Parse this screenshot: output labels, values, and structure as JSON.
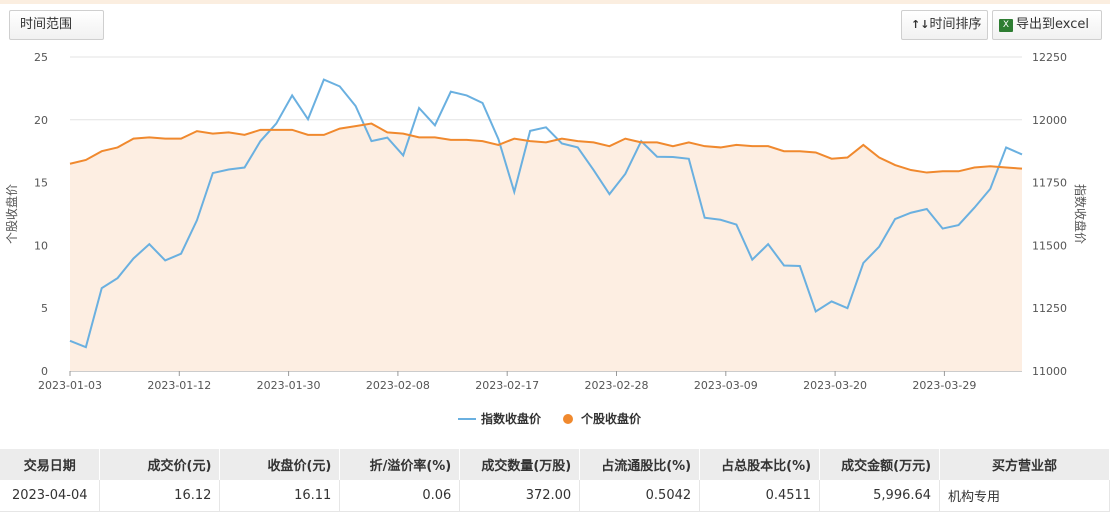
{
  "toolbar": {
    "range_label": "时间范围",
    "sort_label": "时间排序",
    "sort_icon": "↑↓",
    "export_label": "导出到excel",
    "export_icon": "X"
  },
  "chart_data": {
    "type": "line",
    "x_ticks": [
      "2023-01-03",
      "2023-01-12",
      "2023-01-30",
      "2023-02-08",
      "2023-02-17",
      "2023-02-28",
      "2023-03-09",
      "2023-03-20",
      "2023-03-29"
    ],
    "y_left": {
      "label": "个股收盘价",
      "ticks": [
        0,
        5,
        10,
        15,
        20,
        25
      ],
      "range": [
        0,
        25
      ]
    },
    "y_right": {
      "label": "指数收盘价",
      "ticks": [
        11000,
        11250,
        11500,
        11750,
        12000,
        12250
      ],
      "range": [
        11000,
        12250
      ]
    },
    "series": [
      {
        "name": "指数收盘价",
        "axis": "right",
        "color": "#6ab0e0",
        "values": [
          11120,
          11095,
          11330,
          11370,
          11448,
          11505,
          11440,
          11467,
          11600,
          11788,
          11802,
          11810,
          11915,
          11985,
          12097,
          12002,
          12160,
          12133,
          12055,
          11915,
          11929,
          11858,
          12047,
          11978,
          12112,
          12097,
          12067,
          11923,
          11713,
          11956,
          11970,
          11906,
          11890,
          11800,
          11704,
          11785,
          11915,
          11853,
          11852,
          11845,
          11610,
          11602,
          11583,
          11443,
          11505,
          11420,
          11418,
          11237,
          11277,
          11250,
          11430,
          11495,
          11605,
          11630,
          11645,
          11567,
          11581,
          11650,
          11725,
          11890,
          11862
        ]
      },
      {
        "name": "个股收盘价",
        "axis": "left",
        "color": "#f0892e",
        "values": [
          16.5,
          16.8,
          17.5,
          17.8,
          18.5,
          18.6,
          18.5,
          18.5,
          19.1,
          18.9,
          19.0,
          18.8,
          19.2,
          19.2,
          19.2,
          18.8,
          18.8,
          19.3,
          19.5,
          19.7,
          19.0,
          18.9,
          18.6,
          18.6,
          18.4,
          18.4,
          18.3,
          18.0,
          18.5,
          18.3,
          18.2,
          18.5,
          18.3,
          18.2,
          17.9,
          18.5,
          18.2,
          18.2,
          17.9,
          18.2,
          17.9,
          17.8,
          18.0,
          17.9,
          17.9,
          17.5,
          17.5,
          17.4,
          16.9,
          17.0,
          18.0,
          17.0,
          16.4,
          16.0,
          15.8,
          15.9,
          15.9,
          16.2,
          16.3,
          16.2,
          16.11
        ]
      }
    ]
  },
  "table": {
    "headers": [
      "交易日期",
      "成交价(元)",
      "收盘价(元)",
      "折/溢价率(%)",
      "成交数量(万股)",
      "占流通股比(%)",
      "占总股本比(%)",
      "成交金额(万元)",
      "买方营业部"
    ],
    "rows": [
      [
        "2023-04-04",
        "16.12",
        "16.11",
        "0.06",
        "372.00",
        "0.5042",
        "0.4511",
        "5,996.64",
        "机构专用"
      ]
    ]
  }
}
